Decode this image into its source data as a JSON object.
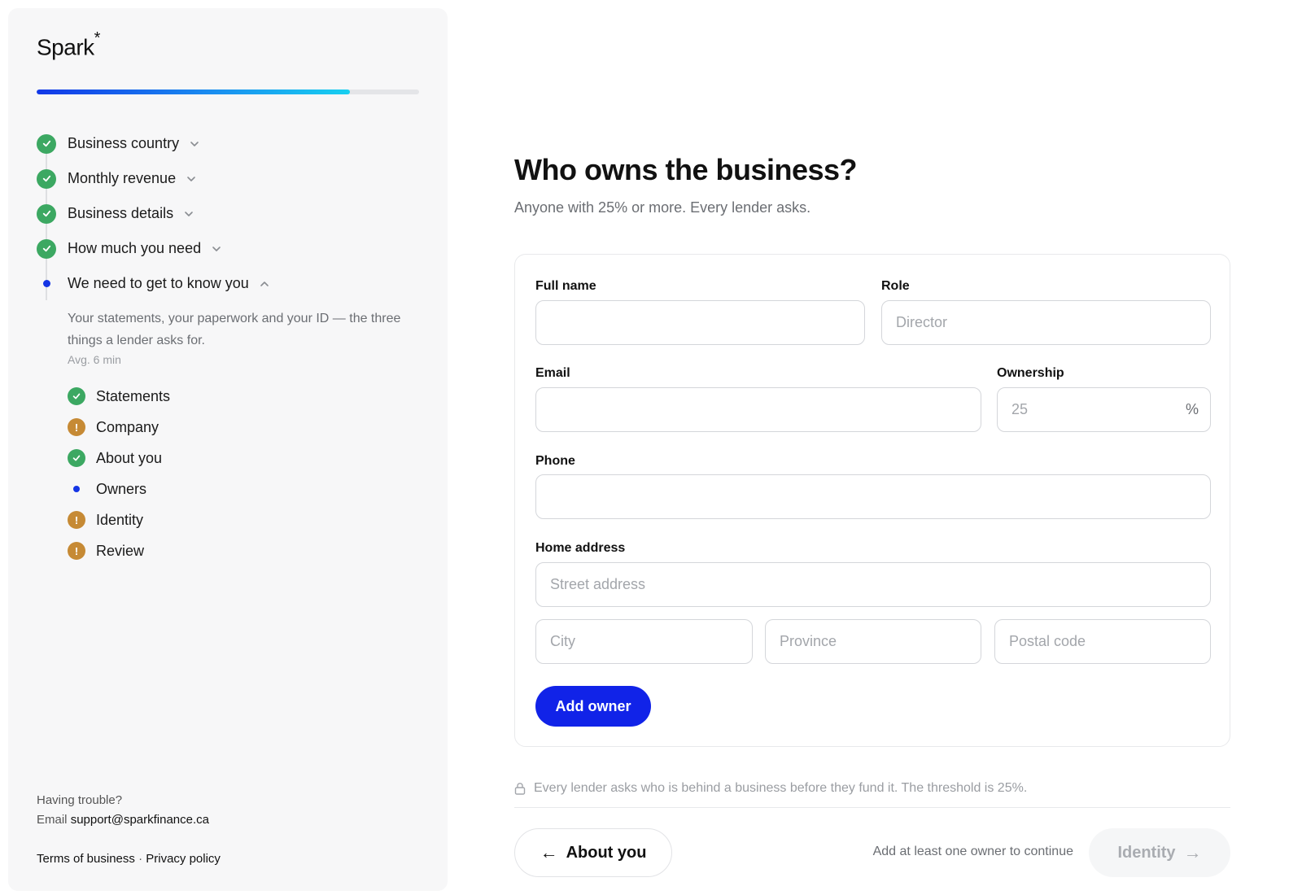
{
  "brand": {
    "name": "Spark",
    "mark": "*"
  },
  "progress": {
    "fraction": 0.82
  },
  "colors": {
    "accent": "#1123e8",
    "complete": "#3ca862",
    "warning": "#c68a35",
    "current": "#1535e5"
  },
  "steps": [
    {
      "label": "Business country",
      "status": "complete",
      "icon": "check-icon"
    },
    {
      "label": "Monthly revenue",
      "status": "complete",
      "icon": "check-icon"
    },
    {
      "label": "Business details",
      "status": "complete",
      "icon": "check-icon"
    },
    {
      "label": "How much you need",
      "status": "complete",
      "icon": "check-icon"
    },
    {
      "label": "We need to get to know you",
      "status": "current",
      "icon": "dot-icon"
    }
  ],
  "current_section": {
    "description": "Your statements, your paperwork and your ID — the three things a lender asks for.",
    "avg": "Avg. 6 min",
    "substeps": [
      {
        "label": "Statements",
        "status": "complete"
      },
      {
        "label": "Company",
        "status": "warning"
      },
      {
        "label": "About you",
        "status": "complete"
      },
      {
        "label": "Owners",
        "status": "current"
      },
      {
        "label": "Identity",
        "status": "warning"
      },
      {
        "label": "Review",
        "status": "warning"
      }
    ]
  },
  "help": {
    "question": "Having trouble?",
    "email_prefix": "Email",
    "email": "support@sparkfinance.ca"
  },
  "footer": {
    "terms": "Terms of business",
    "separator": "·",
    "privacy": "Privacy policy"
  },
  "main": {
    "title": "Who owns the business?",
    "subtitle": "Anyone with 25% or more. Every lender asks.",
    "form": {
      "full_name": {
        "label": "Full name",
        "value": "",
        "placeholder": ""
      },
      "role": {
        "label": "Role",
        "value": "",
        "placeholder": "Director"
      },
      "email": {
        "label": "Email",
        "value": "",
        "placeholder": ""
      },
      "ownership": {
        "label": "Ownership",
        "value": "",
        "placeholder": "25",
        "suffix": "%"
      },
      "phone": {
        "label": "Phone",
        "value": "",
        "placeholder": ""
      },
      "address": {
        "label": "Home address",
        "street_placeholder": "Street address",
        "city_placeholder": "City",
        "province_placeholder": "Province",
        "postal_placeholder": "Postal code"
      },
      "add_button": "Add owner"
    },
    "note": "Every lender asks who is behind a business before they fund it. The threshold is 25%.",
    "nav": {
      "back_arrow": "←",
      "back_label": "About you",
      "hint": "Add at least one owner to continue",
      "next_label": "Identity",
      "next_arrow": "→"
    }
  }
}
